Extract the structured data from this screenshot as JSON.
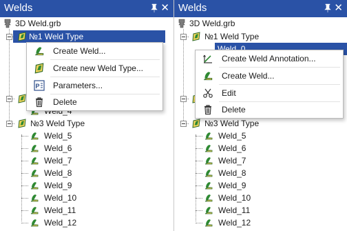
{
  "colors": {
    "titlebar": "#2a52a6",
    "selection": "#2a52a6",
    "weld_icon": "#1e7a2e"
  },
  "left": {
    "title": "Welds",
    "tree": {
      "root": "3D Weld.grb",
      "type1": "№1 Weld Type",
      "weld4": "Weld_4",
      "type3": "№3 Weld Type",
      "welds": [
        "Weld_5",
        "Weld_6",
        "Weld_7",
        "Weld_8",
        "Weld_9",
        "Weld_10",
        "Weld_11",
        "Weld_12"
      ]
    },
    "menu": {
      "items": [
        "Create Weld...",
        "Create new Weld Type...",
        "Parameters...",
        "Delete"
      ],
      "icons": [
        "weld-icon",
        "weld-type-icon",
        "parameters-icon",
        "trash-icon"
      ]
    }
  },
  "right": {
    "title": "Welds",
    "tree": {
      "root": "3D Weld.grb",
      "type1": "№1 Weld Type",
      "weld0": "Weld_0",
      "type3": "№3 Weld Type",
      "welds": [
        "Weld_5",
        "Weld_6",
        "Weld_7",
        "Weld_8",
        "Weld_9",
        "Weld_10",
        "Weld_11",
        "Weld_12"
      ]
    },
    "menu": {
      "items": [
        "Create Weld Annotation...",
        "Create Weld...",
        "Edit",
        "Delete"
      ],
      "icons": [
        "weld-annotation-icon",
        "weld-icon",
        "scissors-icon",
        "trash-icon"
      ]
    }
  }
}
